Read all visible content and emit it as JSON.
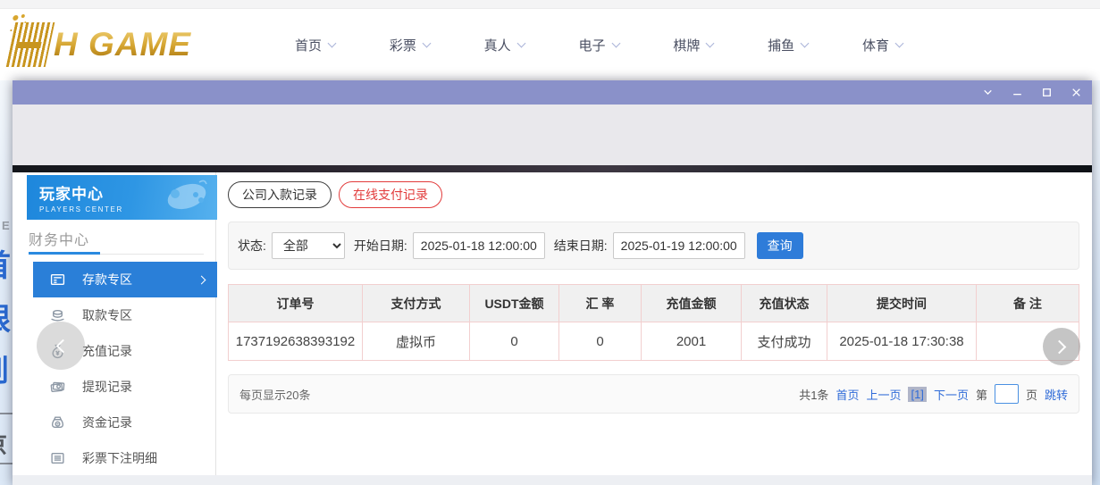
{
  "logo": {
    "text": "H GAME"
  },
  "topnav": {
    "items": [
      {
        "label": "首页"
      },
      {
        "label": "彩票"
      },
      {
        "label": "真人"
      },
      {
        "label": "电子"
      },
      {
        "label": "棋牌"
      },
      {
        "label": "捕鱼"
      },
      {
        "label": "体育"
      }
    ]
  },
  "background_page": {
    "left_edge_fragments": {
      "f0": "E",
      "f1": "首",
      "f2": "限",
      "f3": "到",
      "f4": "京"
    }
  },
  "window": {
    "controls": {
      "collapse": "chevron-down",
      "minimize": "minus",
      "maximize": "square",
      "close": "x"
    }
  },
  "sidebar": {
    "title": "玩家中心",
    "subtitle": "PLAYERS CENTER",
    "section": "财务中心",
    "items": [
      {
        "label": "存款专区",
        "icon": "deposit-icon",
        "active": true
      },
      {
        "label": "取款专区",
        "icon": "withdraw-icon"
      },
      {
        "label": "充值记录",
        "icon": "recharge-record-icon"
      },
      {
        "label": "提现记录",
        "icon": "cashout-record-icon"
      },
      {
        "label": "资金记录",
        "icon": "funds-record-icon"
      },
      {
        "label": "彩票下注明细",
        "icon": "lottery-detail-icon"
      }
    ]
  },
  "tabs": [
    {
      "label": "公司入款记录"
    },
    {
      "label": "在线支付记录",
      "active": true
    }
  ],
  "filters": {
    "status_label": "状态:",
    "status_value": "全部",
    "start_label": "开始日期:",
    "start_value": "2025-01-18 12:00:00",
    "end_label": "结束日期:",
    "end_value": "2025-01-19 12:00:00",
    "search_label": "查询"
  },
  "table": {
    "headers": [
      "订单号",
      "支付方式",
      "USDT金额",
      "汇 率",
      "充值金额",
      "充值状态",
      "提交时间",
      "备 注"
    ],
    "rows": [
      [
        "1737192638393192",
        "虚拟币",
        "0",
        "0",
        "2001",
        "支付成功",
        "2025-01-18 17:30:38",
        ""
      ]
    ]
  },
  "pagination": {
    "page_size_text": "每页显示20条",
    "total_text": "共1条",
    "first": "首页",
    "prev": "上一页",
    "current": "[1]",
    "next": "下一页",
    "jump_prefix": "第",
    "jump_suffix": "页",
    "jump_label": "跳转"
  },
  "colors": {
    "accent_blue": "#2e7cd9",
    "sidebar_active_blue": "#2a7fd8",
    "tab_active_red": "#e23b3b",
    "titlebar_purple": "#8a91c9",
    "link_blue": "#2f6bd8",
    "table_border_pink": "#f2cfcf",
    "logo_gold": "#d3a22e"
  }
}
